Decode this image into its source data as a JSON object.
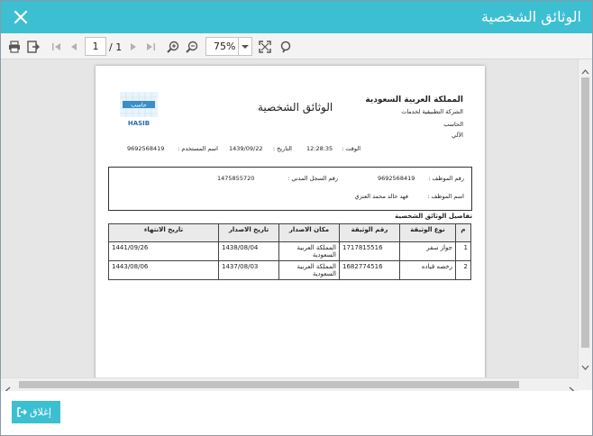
{
  "window": {
    "title": "الوثائق الشخصية",
    "accent": "#3dbfd2"
  },
  "toolbar": {
    "page_current": "1",
    "page_total": "/ 1",
    "zoom": "75%"
  },
  "report": {
    "kingdom": "المملكة العربية السعودية",
    "company": "الشركة التطبيقية لخدمات",
    "hasib": "الحاسب",
    "ali": "الآلي",
    "title": "الوثائق الشخصية",
    "logo_arabic": "حاسب",
    "logo_latin": "HASIB",
    "meta": {
      "time_label": "الوقت :",
      "time_value": "12:28:35",
      "date_label": "التاريخ :",
      "date_value": "1439/09/22",
      "user_label": "اسم المستخدم :",
      "user_value": "9692568419"
    },
    "employee": {
      "id_label": "رقم الموظف :",
      "id_value": "9692568419",
      "civil_label": "رقم السجل المدني :",
      "civil_value": "1475855720",
      "name_label": "اسم الموظف :",
      "name_value": "فهد خالد محمد العنزي"
    },
    "section_title": "تفاصيل الوثائق الشخصية",
    "table": {
      "headers": [
        "م",
        "نوع الوثيقة",
        "رقم الوثيقة",
        "مكان الاصدار",
        "تاريخ الاصدار",
        "تاريخ الانتهاء"
      ],
      "rows": [
        [
          "1",
          "جواز سفر",
          "1717815516",
          "المملكة العربية السعودية",
          "1438/08/04",
          "1441/09/26"
        ],
        [
          "2",
          "رخصه قياده",
          "1682774516",
          "المملكة العربية السعودية",
          "1437/08/03",
          "1443/08/06"
        ]
      ]
    }
  },
  "footer": {
    "close_label": "إغلاق"
  }
}
